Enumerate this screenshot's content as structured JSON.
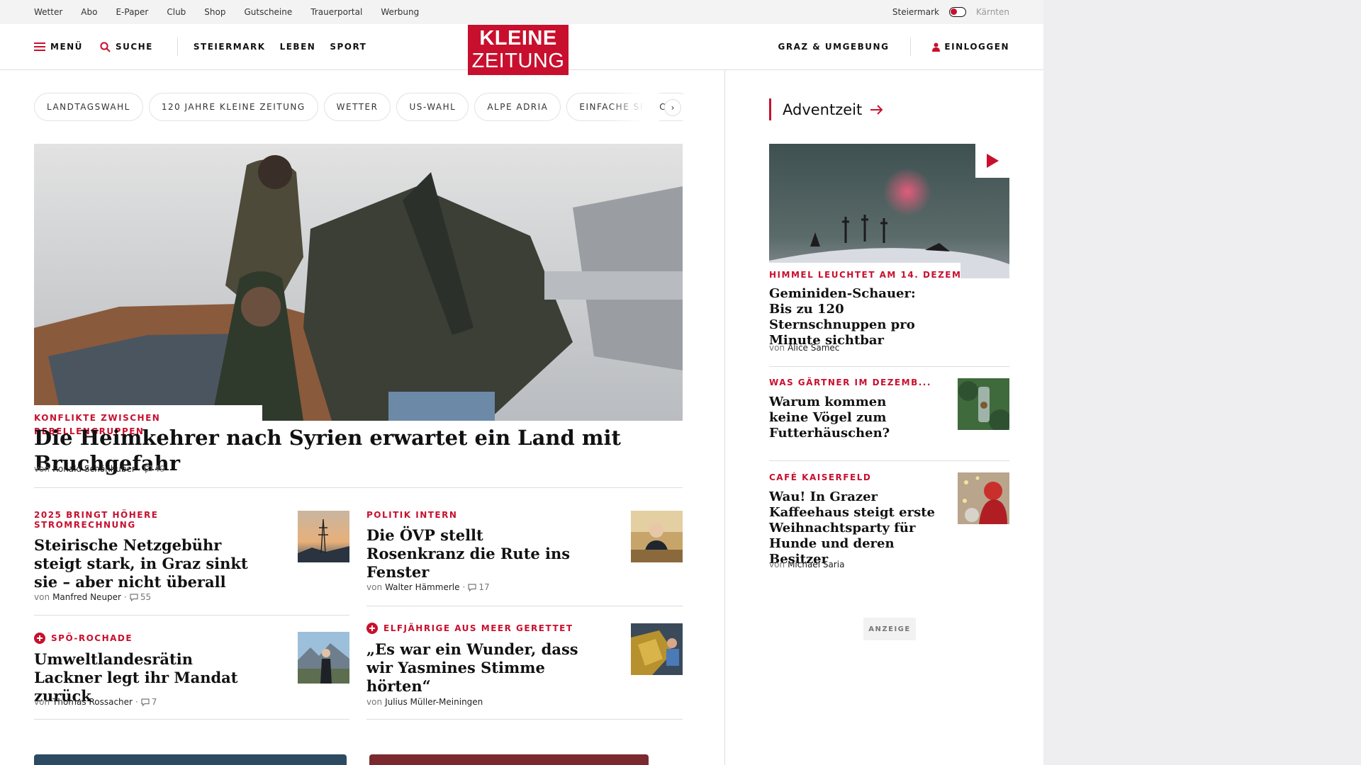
{
  "utility_nav": [
    "Wetter",
    "Abo",
    "E-Paper",
    "Club",
    "Shop",
    "Gutscheine",
    "Trauerportal",
    "Werbung"
  ],
  "region": {
    "current": "Steiermark",
    "other": "Kärnten"
  },
  "header": {
    "menu_label": "MENÜ",
    "search_label": "SUCHE",
    "nav": [
      "STEIERMARK",
      "LEBEN",
      "SPORT"
    ],
    "logo_line1": "KLEINE",
    "logo_line2": "ZEITUNG",
    "local_label": "GRAZ & UMGEBUNG",
    "login_label": "EINLOGGEN"
  },
  "topics": [
    "LANDTAGSWAHL",
    "120 JAHRE KLEINE ZEITUNG",
    "WETTER",
    "US-WAHL",
    "ALPE ADRIA",
    "EINFACHE SPRACHE"
  ],
  "hero": {
    "kicker": "KONFLIKTE ZWISCHEN REBELLENGRUPPEN",
    "title": "Die Heimkehrer nach Syrien erwartet ein Land mit Bruchgefahr",
    "by": "von",
    "author": "Ronald Schönhuber",
    "comments": "49"
  },
  "teasers": [
    {
      "kicker": "2025 BRINGT HÖHERE STROMRECHNUNG",
      "title": "Steirische Netzgebühr steigt stark, in Graz sinkt sie – aber nicht überall",
      "by": "von",
      "author": "Manfred Neuper",
      "comments": "55"
    },
    {
      "kicker": "POLITIK INTERN",
      "title": "Die ÖVP stellt Rosenkranz die Rute ins Fenster",
      "by": "von",
      "author": "Walter Hämmerle",
      "comments": "17"
    },
    {
      "kicker": "SPÖ-ROCHADE",
      "title": "Umweltlandesrätin Lackner legt ihr Mandat zurück",
      "by": "von",
      "author": "Thomas Rossacher",
      "comments": "7"
    },
    {
      "kicker": "ELFJÄHRIGE AUS MEER GERETTET",
      "title": "„Es war ein Wunder, dass wir Yasmines Stimme hörten“",
      "by": "von",
      "author": "Julius Müller-Meiningen"
    }
  ],
  "sidebar": {
    "section_title": "Adventzeit",
    "items": [
      {
        "kicker": "HIMMEL LEUCHTET AM 14. DEZEM...",
        "title": "Geminiden-Schauer: Bis zu 120 Sternschnuppen pro Minute sichtbar",
        "by": "von",
        "author": "Alice Samec"
      },
      {
        "kicker": "WAS GÄRTNER IM DEZEMB...",
        "title": "Warum kommen keine Vögel zum Futterhäuschen?"
      },
      {
        "kicker": "CAFÉ KAISERFELD",
        "title": "Wau! In Grazer Kaffeehaus steigt erste Weihnachtsparty für Hunde und deren Besitzer",
        "by": "von",
        "author": "Michael Saria"
      }
    ],
    "ad_label": "ANZEIGE"
  },
  "colors": {
    "brand_red": "#c8102e",
    "text": "#111111",
    "muted": "#777777",
    "divider": "#dddddd",
    "page_bg": "#eeeef1"
  },
  "icons": [
    "hamburger-icon",
    "search-icon",
    "user-icon",
    "arrow-right-icon",
    "chevron-right-icon",
    "play-icon",
    "comment-icon",
    "plus-circle-icon"
  ]
}
